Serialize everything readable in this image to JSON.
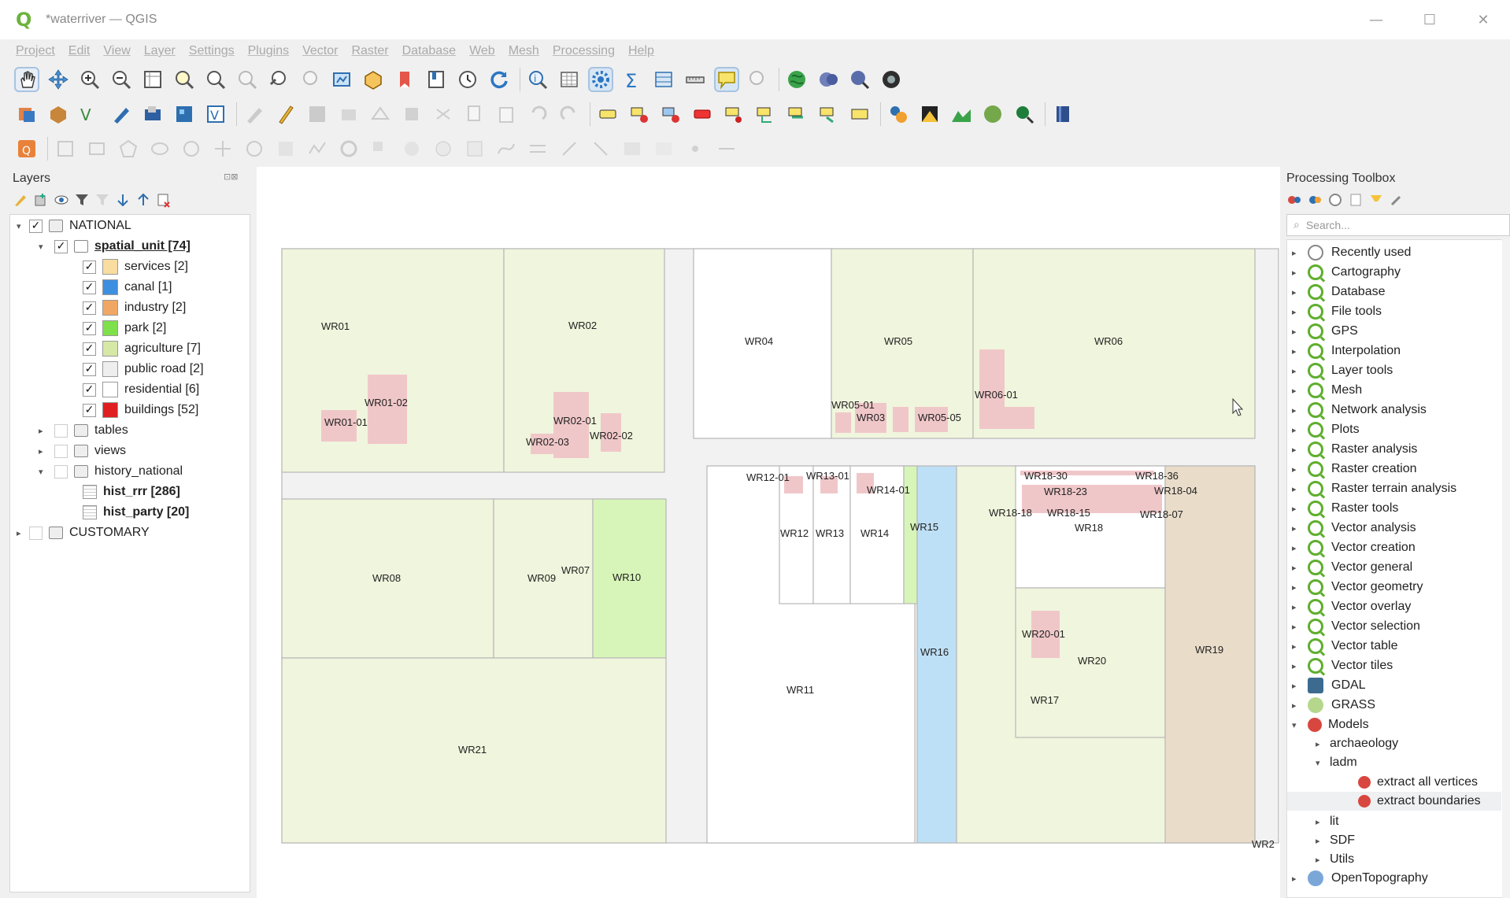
{
  "window": {
    "title": "*waterriver — QGIS",
    "min": "—",
    "max": "☐",
    "close": "✕"
  },
  "menu": [
    "Project",
    "Edit",
    "View",
    "Layer",
    "Settings",
    "Plugins",
    "Vector",
    "Raster",
    "Database",
    "Web",
    "Mesh",
    "Processing",
    "Help"
  ],
  "layers_panel": {
    "title": "Layers",
    "items": [
      {
        "label": "NATIONAL",
        "checked": true,
        "expanded": true
      },
      {
        "label": "spatial_unit [74]",
        "checked": true,
        "expanded": true
      },
      {
        "label": "services [2]",
        "checked": true,
        "color": "#f8dca0"
      },
      {
        "label": "canal [1]",
        "checked": true,
        "color": "#3d8fe0"
      },
      {
        "label": "industry [2]",
        "checked": true,
        "color": "#f0a763"
      },
      {
        "label": "park [2]",
        "checked": true,
        "color": "#7ee04a"
      },
      {
        "label": "agriculture [7]",
        "checked": true,
        "color": "#d6e8a6"
      },
      {
        "label": "public road [2]",
        "checked": true,
        "color": "#eeeeee"
      },
      {
        "label": "residential [6]",
        "checked": true,
        "color": "#ffffff"
      },
      {
        "label": "buildings [52]",
        "checked": true,
        "color": "#e02020"
      },
      {
        "label": "tables",
        "checked": false,
        "expanded": false
      },
      {
        "label": "views",
        "checked": false,
        "expanded": false
      },
      {
        "label": "history_national",
        "checked": false,
        "expanded": true
      },
      {
        "label": "hist_rrr [286]"
      },
      {
        "label": "hist_party [20]"
      },
      {
        "label": "CUSTOMARY",
        "checked": false,
        "expanded": false
      }
    ]
  },
  "map": {
    "colors": {
      "agriculture": "#f0f5dd",
      "park": "#d7f5b8",
      "canal": "#bee0f6",
      "industry": "#e9dcc9",
      "building": "#f0c7c9",
      "road": "#f2f2f2",
      "residential": "#ffffff"
    },
    "labels": {
      "wr01": "WR01",
      "wr01_01": "WR01-01",
      "wr01_02": "WR01-02",
      "wr02": "WR02",
      "wr02_01": "WR02-01",
      "wr02_02": "WR02-02",
      "wr02_03": "WR02-03",
      "wr03": "WR03",
      "wr04": "WR04",
      "wr05": "WR05",
      "wr05_01": "WR05-01",
      "wr05_05": "WR05-05",
      "wr06": "WR06",
      "wr06_01": "WR06-01",
      "wr07": "WR07",
      "wr08": "WR08",
      "wr09": "WR09",
      "wr10": "WR10",
      "wr11": "WR11",
      "wr12": "WR12",
      "wr12_01": "WR12-01",
      "wr13": "WR13",
      "wr13_01": "WR13-01",
      "wr14": "WR14",
      "wr14_01": "WR14-01",
      "wr15": "WR15",
      "wr16": "WR16",
      "wr17": "WR17",
      "wr18": "WR18",
      "wr18_30": "WR18-30",
      "wr18_36": "WR18-36",
      "wr18_23": "WR18-23",
      "wr18_04": "WR18-04",
      "wr18_18": "WR18-18",
      "wr18_15": "WR18-15",
      "wr18_07": "WR18-07",
      "wr19": "WR19",
      "wr20": "WR20",
      "wr20_01": "WR20-01",
      "wr21": "WR21",
      "wr2": "WR2"
    }
  },
  "processing_toolbox": {
    "title": "Processing Toolbox",
    "search_placeholder": "Search...",
    "items": [
      {
        "label": "Recently used",
        "icon": "clock-icon"
      },
      {
        "label": "Cartography",
        "icon": "qgis-icon"
      },
      {
        "label": "Database",
        "icon": "qgis-icon"
      },
      {
        "label": "File tools",
        "icon": "qgis-icon"
      },
      {
        "label": "GPS",
        "icon": "qgis-icon"
      },
      {
        "label": "Interpolation",
        "icon": "qgis-icon"
      },
      {
        "label": "Layer tools",
        "icon": "qgis-icon"
      },
      {
        "label": "Mesh",
        "icon": "qgis-icon"
      },
      {
        "label": "Network analysis",
        "icon": "qgis-icon"
      },
      {
        "label": "Plots",
        "icon": "qgis-icon"
      },
      {
        "label": "Raster analysis",
        "icon": "qgis-icon"
      },
      {
        "label": "Raster creation",
        "icon": "qgis-icon"
      },
      {
        "label": "Raster terrain analysis",
        "icon": "qgis-icon"
      },
      {
        "label": "Raster tools",
        "icon": "qgis-icon"
      },
      {
        "label": "Vector analysis",
        "icon": "qgis-icon"
      },
      {
        "label": "Vector creation",
        "icon": "qgis-icon"
      },
      {
        "label": "Vector general",
        "icon": "qgis-icon"
      },
      {
        "label": "Vector geometry",
        "icon": "qgis-icon"
      },
      {
        "label": "Vector overlay",
        "icon": "qgis-icon"
      },
      {
        "label": "Vector selection",
        "icon": "qgis-icon"
      },
      {
        "label": "Vector table",
        "icon": "qgis-icon"
      },
      {
        "label": "Vector tiles",
        "icon": "qgis-icon"
      },
      {
        "label": "GDAL",
        "icon": "gdal-icon"
      },
      {
        "label": "GRASS",
        "icon": "grass-icon"
      },
      {
        "label": "Models",
        "icon": "models-icon"
      },
      {
        "label": "archaeology"
      },
      {
        "label": "ladm"
      },
      {
        "label": "extract all vertices",
        "icon": "model-icon"
      },
      {
        "label": "extract boundaries",
        "icon": "model-icon"
      },
      {
        "label": "lit"
      },
      {
        "label": "SDF"
      },
      {
        "label": "Utils"
      },
      {
        "label": "OpenTopography",
        "icon": "opentopography-icon"
      }
    ]
  }
}
